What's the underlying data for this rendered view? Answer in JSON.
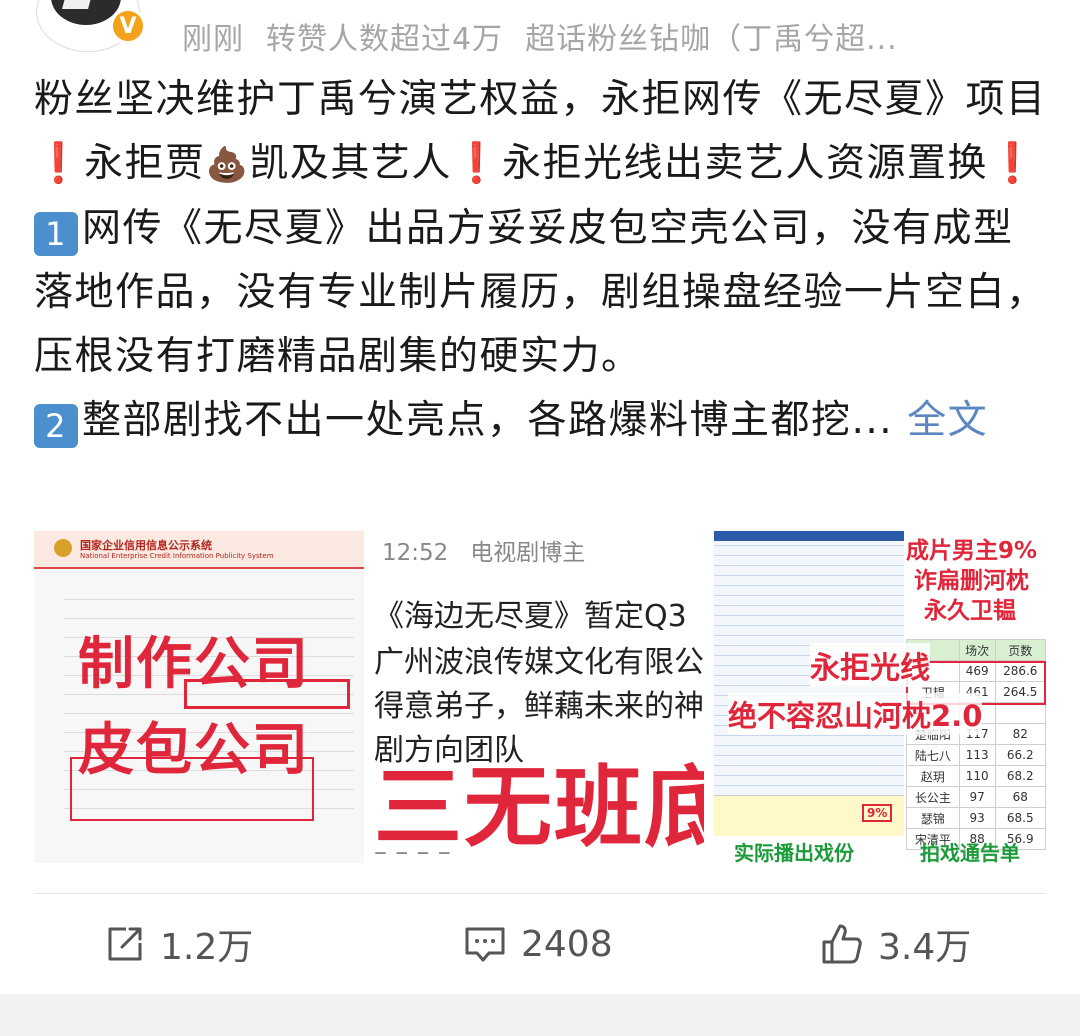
{
  "header": {
    "time": "刚刚",
    "repost_stat": "转赞人数超过4万",
    "source": "超话粉丝钻咖（丁禹兮超..."
  },
  "post": {
    "p1a": "粉丝坚决维护丁禹兮演艺权益，永拒网传《无尽夏》项目",
    "p1b": "永拒贾",
    "p1c": "凯及其艺人",
    "p1d": "永拒光线出卖艺人资源置换",
    "p2_num": "1",
    "p2": "网传《无尽夏》出品方妥妥皮包空壳公司，没有成型落地作品，没有专业制片履历，剧组操盘经验一片空白，压根没有打磨精品剧集的硬实力。",
    "p3_num": "2",
    "p3": "整部剧找不出一处亮点，各路爆料博主都挖...",
    "full_text": "全文"
  },
  "images": {
    "img1": {
      "sys_title": "国家企业信用信息公示系统",
      "sys_sub": "National Enterprise Credit Information Publicity System",
      "line1": "制作公司",
      "line2": "皮包公司"
    },
    "img2": {
      "time": "12:52",
      "account": "电视剧博主",
      "line1": "《海边无尽夏》暂定Q3",
      "line2": "广州波浪传媒文化有限公",
      "line3": "得意弟子，鲜藕未来的神",
      "line4": "剧方向团队",
      "huge": "三无班底",
      "dash": "– – – –"
    },
    "img3": {
      "r1": "成片男主9%",
      "r2": "诈扁删河枕",
      "r3": "永久卫韫",
      "r4": "永拒光线",
      "r5": "绝不容忍山河枕2.0",
      "g1": "实际播出戏份",
      "g2": "拍戏通告单",
      "table_head": [
        "场次",
        "页数"
      ],
      "table_rows": [
        [
          "",
          "469",
          "286.6"
        ],
        [
          "卫韫",
          "461",
          "264.5"
        ],
        [
          "",
          "",
          ""
        ],
        [
          "楚临阳",
          "117",
          "82"
        ],
        [
          "陆七八",
          "113",
          "66.2"
        ],
        [
          "赵玥",
          "110",
          "68.2"
        ],
        [
          "长公主",
          "97",
          "68"
        ],
        [
          "瑟锦",
          "93",
          "68.5"
        ],
        [
          "宋清平",
          "88",
          "56.9"
        ]
      ],
      "bottom_pct": "9%"
    }
  },
  "actions": {
    "repost": "1.2万",
    "comment": "2408",
    "like": "3.4万"
  }
}
